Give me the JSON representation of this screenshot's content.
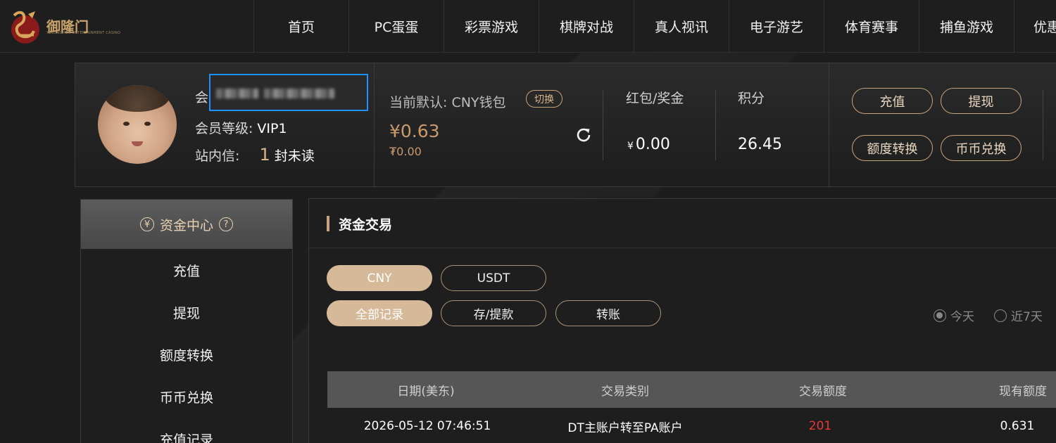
{
  "header": {
    "logo_text": "御隆门",
    "logo_sub": "YULONGMEN ENTERTAINMENT CASINO",
    "nav": [
      "首页",
      "PC蛋蛋",
      "彩票游戏",
      "棋牌对战",
      "真人视讯",
      "电子游艺",
      "体育赛事",
      "捕鱼游戏",
      "优惠"
    ]
  },
  "profile": {
    "member_label": "会",
    "level_label": "会员等级:",
    "level_value": "VIP1",
    "message_label": "站内信:",
    "message_count": "1",
    "message_suffix": "封未读",
    "wallet_label": "当前默认: CNY钱包",
    "switch_label": "切换",
    "wallet_main": "¥0.63",
    "wallet_sub": "₮0.00",
    "bonus_label": "红包/奖金",
    "bonus_currency": "¥",
    "bonus_value": "0.00",
    "points_label": "积分",
    "points_value": "26.45",
    "actions": [
      "充值",
      "提现",
      "额度转换",
      "币币兑换"
    ]
  },
  "sidebar": {
    "title": "资金中心",
    "title_icon": "¥",
    "help_icon": "?",
    "items": [
      "充值",
      "提现",
      "额度转换",
      "币币兑换",
      "充值记录"
    ]
  },
  "main": {
    "title": "资金交易",
    "currency_tabs": [
      "CNY",
      "USDT"
    ],
    "record_tabs": [
      "全部记录",
      "存/提款",
      "转账"
    ],
    "range_options": [
      "今天",
      "近7天"
    ],
    "columns": [
      "日期(美东)",
      "交易类别",
      "交易额度",
      "现有额度"
    ],
    "rows": [
      [
        "2026-05-12 07:46:51",
        "DT主账户转至PA账户",
        "201",
        "0.631"
      ]
    ]
  },
  "colors": {
    "accent": "#c8a27c",
    "active_chip": "#d6b998",
    "negative": "#e53935",
    "selection": "#1e90ff"
  }
}
